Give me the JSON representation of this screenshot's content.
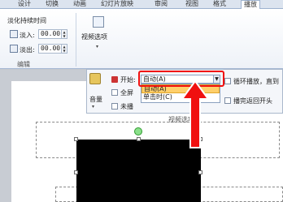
{
  "tabs": [
    "设计",
    "切换",
    "动画",
    "幻灯片放映",
    "审阅",
    "视图",
    "格式",
    "播放"
  ],
  "active_tab": "播放",
  "fade": {
    "title": "淡化持续时间",
    "in_label": "淡入:",
    "in_value": "00.00",
    "out_label": "淡出:",
    "out_value": "00.00",
    "group_label": "编辑"
  },
  "video_options": {
    "button_label": "视频选项",
    "volume_label": "音量",
    "start_label": "开始:",
    "start_value": "自动(A)",
    "fullscreen_label": "全屏",
    "hide_label": "未播",
    "loop_label": "循环播放，直到",
    "rewind_label": "播完返回开头",
    "group_label": "视频选项"
  },
  "dropdown": {
    "options": [
      "自动(A)",
      "单击时(C)"
    ],
    "selected_index": 0
  },
  "colors": {
    "annotation": "#f01010",
    "selected_option": "#ffcf6a"
  }
}
